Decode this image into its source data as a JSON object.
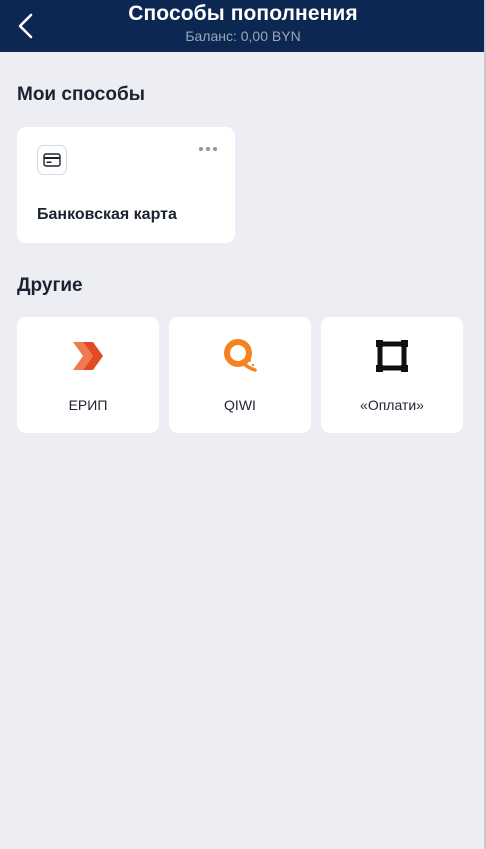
{
  "header": {
    "title": "Способы пополнения",
    "balance": "Баланс: 0,00 BYN"
  },
  "my_methods": {
    "title": "Мои способы",
    "items": [
      {
        "label": "Банковская карта",
        "icon": "credit-card-icon"
      }
    ]
  },
  "other_methods": {
    "title": "Другие",
    "items": [
      {
        "label": "ЕРИП",
        "icon": "erip-logo-icon"
      },
      {
        "label": "QIWI",
        "icon": "qiwi-logo-icon"
      },
      {
        "label": "«Оплати»",
        "icon": "oplati-logo-icon"
      }
    ]
  },
  "colors": {
    "header_bg": "#0c2751",
    "page_bg": "#eceef3",
    "erip_orange": "#e8572a",
    "qiwi_orange": "#f58220"
  }
}
